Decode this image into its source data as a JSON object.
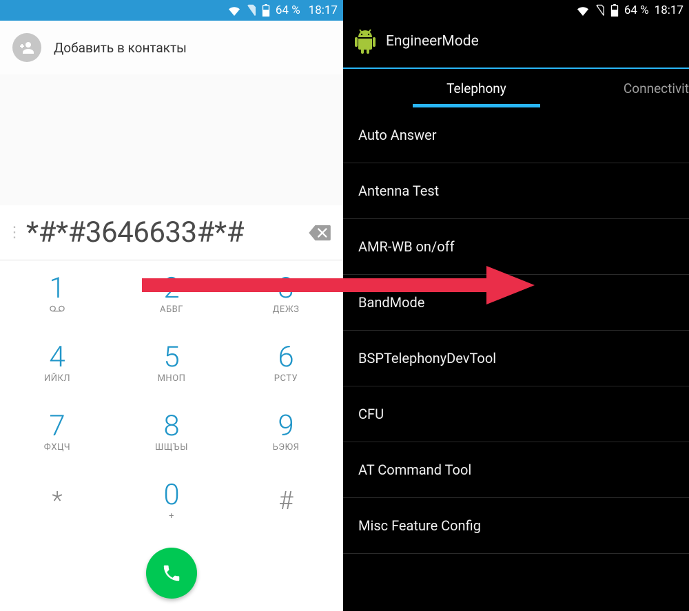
{
  "status": {
    "battery_pct": "64 %",
    "time": "18:17"
  },
  "dialer": {
    "add_contact_label": "Добавить в контакты",
    "number": "*#*#3646633#*#",
    "keys": [
      {
        "digit": "1",
        "sub": ""
      },
      {
        "digit": "2",
        "sub": "АБВГ"
      },
      {
        "digit": "3",
        "sub": "ДЕЖЗ"
      },
      {
        "digit": "4",
        "sub": "ИЙКЛ"
      },
      {
        "digit": "5",
        "sub": "МНОП"
      },
      {
        "digit": "6",
        "sub": "РСТУ"
      },
      {
        "digit": "7",
        "sub": "ФХЦЧ"
      },
      {
        "digit": "8",
        "sub": "ШЩЪЫ"
      },
      {
        "digit": "9",
        "sub": "ЬЭЮЯ"
      },
      {
        "digit": "*",
        "sub": ""
      },
      {
        "digit": "0",
        "sub": "+"
      },
      {
        "digit": "#",
        "sub": ""
      }
    ],
    "one_sub_glyph": "⚬⚬"
  },
  "engineer": {
    "app_title": "EngineerMode",
    "tabs": {
      "active": "Telephony",
      "next": "Connectivit"
    },
    "items": [
      "Auto Answer",
      "Antenna Test",
      "AMR-WB on/off",
      "BandMode",
      "BSPTelephonyDevTool",
      "CFU",
      "AT Command Tool",
      "Misc Feature Config"
    ]
  },
  "colors": {
    "accent": "#29b6f6",
    "call_green": "#00c853",
    "arrow": "#ea2e49"
  }
}
